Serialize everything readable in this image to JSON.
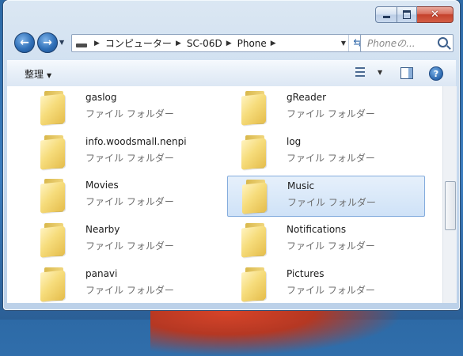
{
  "window": {
    "title": "",
    "controls": {
      "minimize": "—",
      "maximize": "□",
      "close": "✕"
    }
  },
  "nav": {
    "back_icon": "arrow-left-icon",
    "forward_icon": "arrow-right-icon",
    "breadcrumbs": [
      "コンピューター",
      "SC-06D",
      "Phone"
    ],
    "search_placeholder": "Phoneの..."
  },
  "toolbar": {
    "organize_label": "整理"
  },
  "folder_type": "ファイル フォルダー",
  "items": [
    {
      "name": "gaslog",
      "type": "ファイル フォルダー",
      "selected": false
    },
    {
      "name": "gReader",
      "type": "ファイル フォルダー",
      "selected": false
    },
    {
      "name": "info.woodsmall.nenpi",
      "type": "ファイル フォルダー",
      "selected": false
    },
    {
      "name": "log",
      "type": "ファイル フォルダー",
      "selected": false
    },
    {
      "name": "Movies",
      "type": "ファイル フォルダー",
      "selected": false
    },
    {
      "name": "Music",
      "type": "ファイル フォルダー",
      "selected": true
    },
    {
      "name": "Nearby",
      "type": "ファイル フォルダー",
      "selected": false
    },
    {
      "name": "Notifications",
      "type": "ファイル フォルダー",
      "selected": false
    },
    {
      "name": "panavi",
      "type": "ファイル フォルダー",
      "selected": false
    },
    {
      "name": "Pictures",
      "type": "ファイル フォルダー",
      "selected": false
    }
  ]
}
